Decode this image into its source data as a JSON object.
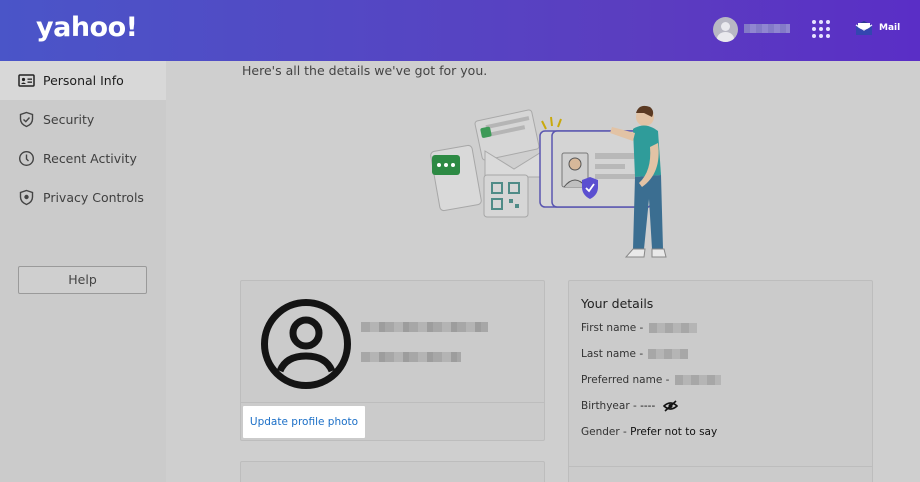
{
  "header": {
    "logo": "yahoo!",
    "mail_label": "Mail",
    "colors": {
      "gradient_start": "#4a55c8",
      "gradient_end": "#5a2ec6"
    },
    "icons": [
      "user-avatar-icon",
      "apps-grid-icon",
      "mail-envelope-icon"
    ]
  },
  "sidebar": {
    "items": [
      {
        "label": "Personal Info",
        "icon": "id-card-icon",
        "active": true
      },
      {
        "label": "Security",
        "icon": "shield-check-icon",
        "active": false
      },
      {
        "label": "Recent Activity",
        "icon": "clock-icon",
        "active": false
      },
      {
        "label": "Privacy Controls",
        "icon": "privacy-shield-icon",
        "active": false
      }
    ],
    "help_label": "Help"
  },
  "main": {
    "intro": "Here's all the details we've got for you.",
    "profile": {
      "update_photo_label": "Update profile photo",
      "link_color": "#1b6fc7"
    },
    "details": {
      "title": "Your details",
      "rows": [
        {
          "label": "First name - ",
          "value": ""
        },
        {
          "label": "Last name - ",
          "value": ""
        },
        {
          "label": "Preferred name - ",
          "value": ""
        },
        {
          "label": "Birthyear - ",
          "value": "----"
        },
        {
          "label": "Gender - ",
          "value": "Prefer not to say"
        }
      ]
    }
  }
}
